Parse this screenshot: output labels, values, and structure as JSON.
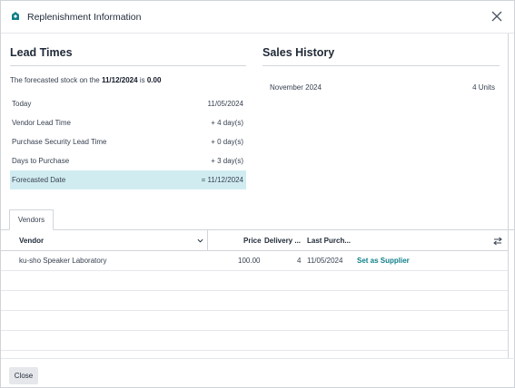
{
  "dialog": {
    "title": "Replenishment Information",
    "close_button": "Close"
  },
  "lead_times": {
    "title": "Lead Times",
    "forecast_prefix": "The forecasted stock on the",
    "forecast_date": "11/12/2024",
    "forecast_mid": "is",
    "forecast_qty": "0.00",
    "rows": [
      {
        "label": "Today",
        "value": "11/05/2024"
      },
      {
        "label": "Vendor Lead Time",
        "value": "+ 4 day(s)"
      },
      {
        "label": "Purchase Security Lead Time",
        "value": "+ 0 day(s)"
      },
      {
        "label": "Days to Purchase",
        "value": "+ 3 day(s)"
      },
      {
        "label": "Forecasted Date",
        "value": "= 11/12/2024"
      }
    ]
  },
  "sales_history": {
    "title": "Sales History",
    "rows": [
      {
        "period": "November 2024",
        "value": "4 Units"
      }
    ]
  },
  "vendors": {
    "tab_label": "Vendors",
    "columns": {
      "vendor": "Vendor",
      "price": "Price",
      "delivery": "Delivery ...",
      "last_purchase": "Last Purch..."
    },
    "rows": [
      {
        "vendor": "ku-sho Speaker Laboratory",
        "price": "100.00",
        "delivery": "4",
        "last_purchase": "11/05/2024",
        "action": "Set as Supplier"
      }
    ]
  },
  "colors": {
    "accent": "#0f7f8a",
    "highlight_row": "#d1ecf1",
    "app_icon": "#0f7f8a"
  }
}
